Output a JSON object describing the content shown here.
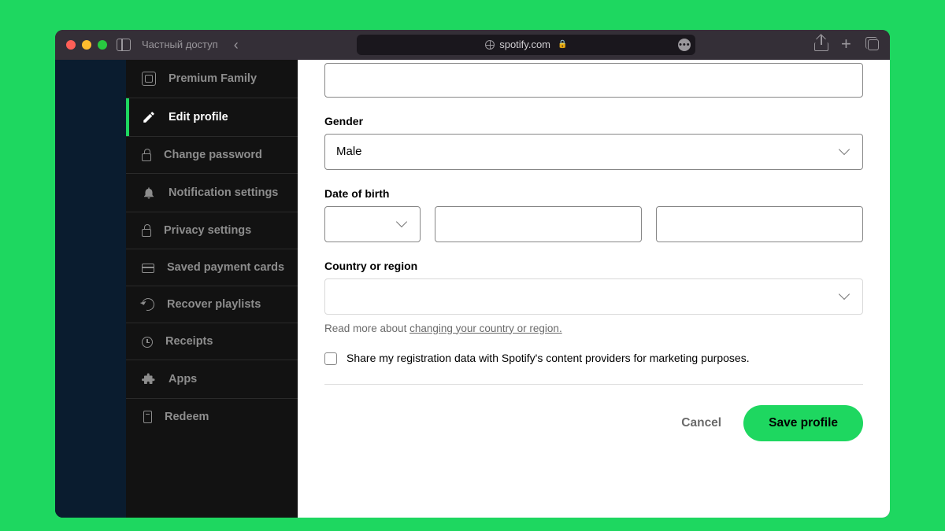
{
  "browser": {
    "sidebar_label": "Частный доступ",
    "url": "spotify.com"
  },
  "sidebar": {
    "items": [
      {
        "label": "Premium Family",
        "icon": "family"
      },
      {
        "label": "Edit profile",
        "icon": "pencil",
        "active": true
      },
      {
        "label": "Change password",
        "icon": "lock"
      },
      {
        "label": "Notification settings",
        "icon": "bell"
      },
      {
        "label": "Privacy settings",
        "icon": "lock"
      },
      {
        "label": "Saved payment cards",
        "icon": "card"
      },
      {
        "label": "Recover playlists",
        "icon": "recover"
      },
      {
        "label": "Receipts",
        "icon": "receipt"
      },
      {
        "label": "Apps",
        "icon": "apps"
      },
      {
        "label": "Redeem",
        "icon": "redeem"
      }
    ]
  },
  "form": {
    "gender_label": "Gender",
    "gender_value": "Male",
    "dob_label": "Date of birth",
    "dob_day": "",
    "dob_month": "",
    "dob_year": "",
    "country_label": "Country or region",
    "country_value": "",
    "country_hint_prefix": "Read more about ",
    "country_hint_link": "changing your country or region.",
    "share_checkbox": "Share my registration data with Spotify's content providers for marketing purposes.",
    "cancel": "Cancel",
    "save": "Save profile"
  }
}
